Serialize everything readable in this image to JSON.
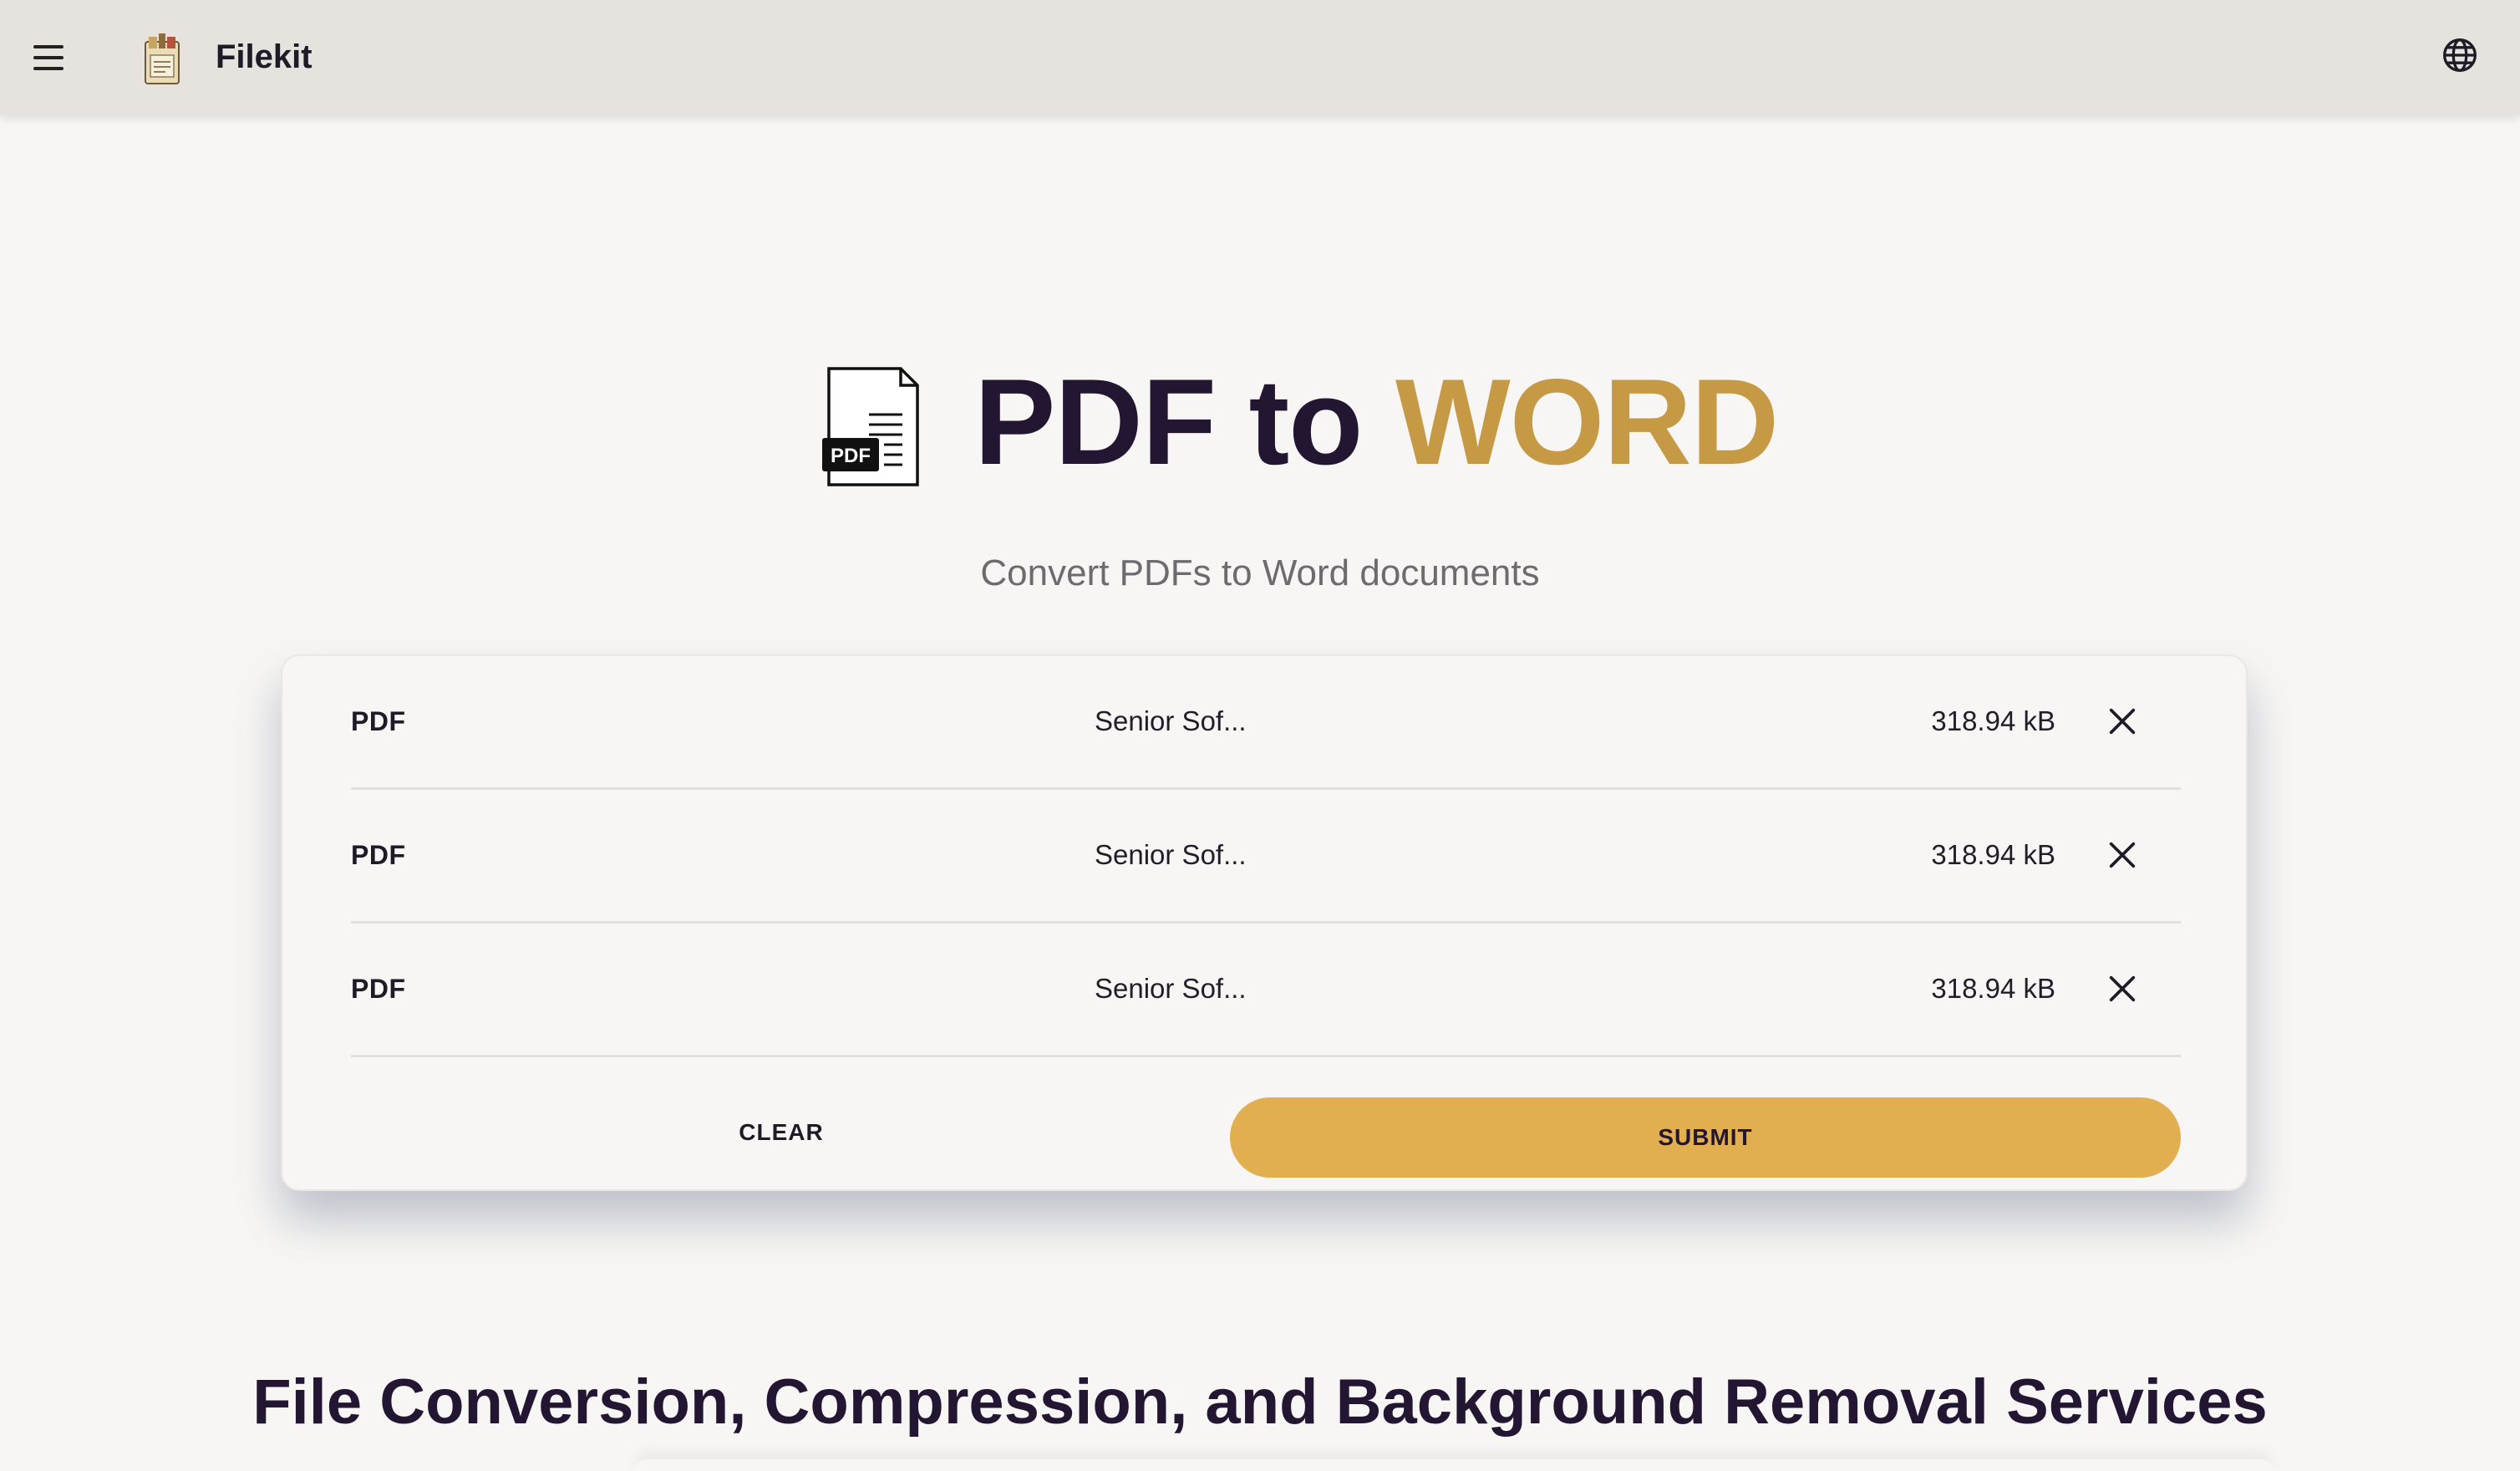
{
  "header": {
    "brand": "Filekit",
    "menu_icon": "hamburger-menu-icon",
    "logo_icon": "filekit-logo-icon",
    "language_icon": "globe-icon"
  },
  "hero": {
    "title_part1": "PDF to",
    "title_part2": "WORD",
    "icon": "pdf-document-icon",
    "icon_badge": "PDF",
    "subtitle": "Convert PDFs to Word documents",
    "colors": {
      "title": "#231632",
      "accent": "#c69a45"
    }
  },
  "files": [
    {
      "type": "PDF",
      "name": "Senior Sof...",
      "size": "318.94 kB",
      "remove_icon": "close-icon"
    },
    {
      "type": "PDF",
      "name": "Senior Sof...",
      "size": "318.94 kB",
      "remove_icon": "close-icon"
    },
    {
      "type": "PDF",
      "name": "Senior Sof...",
      "size": "318.94 kB",
      "remove_icon": "close-icon"
    }
  ],
  "actions": {
    "clear_label": "CLEAR",
    "submit_label": "SUBMIT",
    "submit_color": "#e2af50"
  },
  "section": {
    "title": "File Conversion, Compression, and Background Removal Services"
  }
}
